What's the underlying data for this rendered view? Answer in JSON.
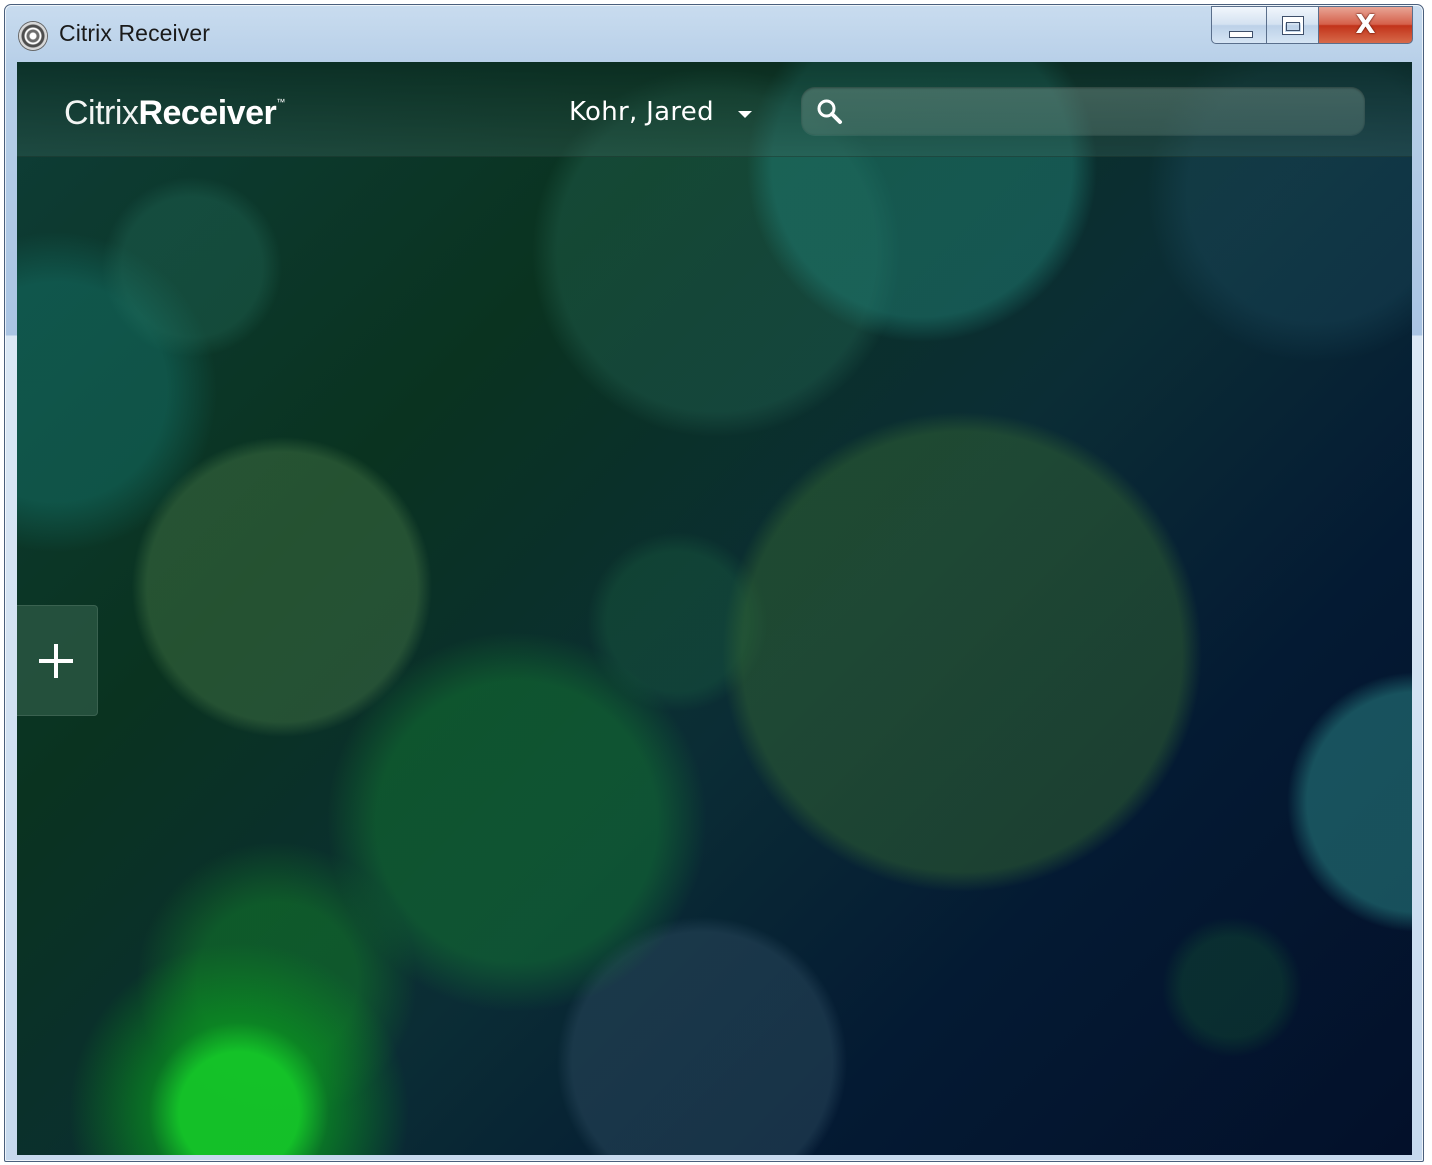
{
  "window": {
    "title": "Citrix Receiver",
    "icon": "citrix-receiver-icon",
    "buttons": {
      "minimize": "minimize-icon",
      "maximize": "maximize-icon",
      "close": "close-icon",
      "close_glyph": "X"
    }
  },
  "header": {
    "brand_light": "Citrix",
    "brand_bold": "Receiver",
    "brand_tm": "™",
    "user_name": "Kohr, Jared",
    "user_menu_icon": "chevron-down-icon"
  },
  "search": {
    "icon": "search-icon",
    "value": "",
    "placeholder": ""
  },
  "sidebar": {
    "add_icon": "plus-icon"
  },
  "colors": {
    "accent_close": "#c2331a",
    "background_dark": "#041a33",
    "highlight_green": "#14c828"
  }
}
